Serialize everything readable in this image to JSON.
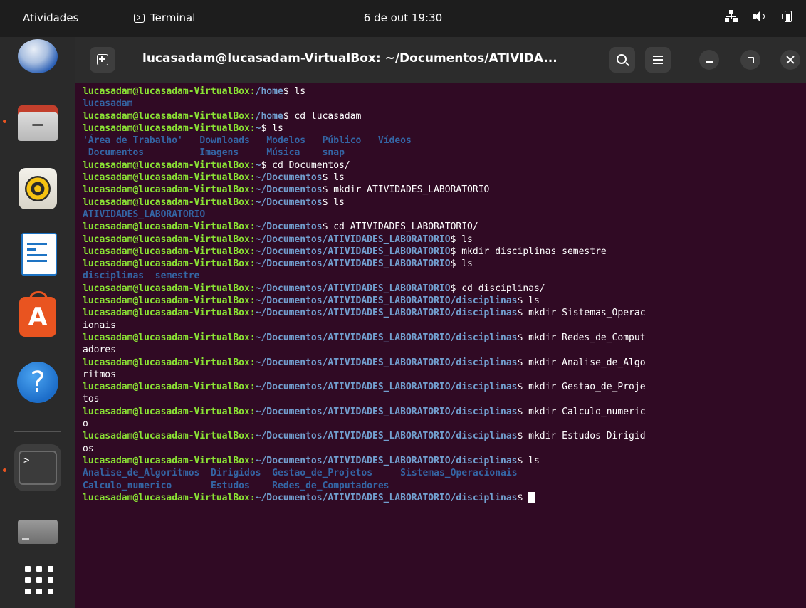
{
  "topbar": {
    "activities": "Atividades",
    "app_name": "Terminal",
    "clock": "6 de out  19:30"
  },
  "dock": {
    "items": [
      "thunderbird-icon",
      "files-icon",
      "rhythmbox-icon",
      "writer-icon",
      "app-center-icon",
      "help-icon",
      "terminal-icon",
      "drive-icon",
      "show-apps-icon"
    ],
    "terminal_prompt": ">_"
  },
  "window": {
    "title": "lucasadam@lucasadam-VirtualBox: ~/Documentos/ATIVIDA..."
  },
  "terminal": {
    "user_host": "lucasadam@lucasadam-VirtualBox",
    "lines": [
      {
        "type": "prompt",
        "path": "/home",
        "cmd": " ls"
      },
      {
        "type": "output",
        "segs": [
          {
            "t": "lucasadam",
            "c": "d"
          }
        ]
      },
      {
        "type": "prompt",
        "path": "/home",
        "cmd": " cd lucasadam"
      },
      {
        "type": "prompt",
        "path": "~",
        "cmd": " ls"
      },
      {
        "type": "output",
        "segs": [
          {
            "t": "'Área de Trabalho'",
            "c": "d"
          },
          {
            "t": "   "
          },
          {
            "t": "Downloads",
            "c": "d"
          },
          {
            "t": "   "
          },
          {
            "t": "Modelos",
            "c": "d"
          },
          {
            "t": "   "
          },
          {
            "t": "Público",
            "c": "d"
          },
          {
            "t": "   "
          },
          {
            "t": "Vídeos",
            "c": "d"
          }
        ]
      },
      {
        "type": "output",
        "segs": [
          {
            "t": " "
          },
          {
            "t": "Documentos",
            "c": "d"
          },
          {
            "t": "          "
          },
          {
            "t": "Imagens",
            "c": "d"
          },
          {
            "t": "     "
          },
          {
            "t": "Música",
            "c": "d"
          },
          {
            "t": "    "
          },
          {
            "t": "snap",
            "c": "d"
          }
        ]
      },
      {
        "type": "prompt",
        "path": "~",
        "cmd": " cd Documentos/"
      },
      {
        "type": "prompt",
        "path": "~/Documentos",
        "cmd": " ls"
      },
      {
        "type": "prompt",
        "path": "~/Documentos",
        "cmd": " mkdir ATIVIDADES_LABORATORIO"
      },
      {
        "type": "prompt",
        "path": "~/Documentos",
        "cmd": " ls"
      },
      {
        "type": "output",
        "segs": [
          {
            "t": "ATIVIDADES_LABORATORIO",
            "c": "d"
          }
        ]
      },
      {
        "type": "prompt",
        "path": "~/Documentos",
        "cmd": " cd ATIVIDADES_LABORATORIO/"
      },
      {
        "type": "prompt",
        "path": "~/Documentos/ATIVIDADES_LABORATORIO",
        "cmd": " ls"
      },
      {
        "type": "prompt",
        "path": "~/Documentos/ATIVIDADES_LABORATORIO",
        "cmd": " mkdir disciplinas semestre"
      },
      {
        "type": "prompt",
        "path": "~/Documentos/ATIVIDADES_LABORATORIO",
        "cmd": " ls"
      },
      {
        "type": "output",
        "segs": [
          {
            "t": "disciplinas",
            "c": "d"
          },
          {
            "t": "  "
          },
          {
            "t": "semestre",
            "c": "d"
          }
        ]
      },
      {
        "type": "prompt",
        "path": "~/Documentos/ATIVIDADES_LABORATORIO",
        "cmd": " cd disciplinas/"
      },
      {
        "type": "prompt",
        "path": "~/Documentos/ATIVIDADES_LABORATORIO/disciplinas",
        "cmd": " ls"
      },
      {
        "type": "prompt",
        "path": "~/Documentos/ATIVIDADES_LABORATORIO/disciplinas",
        "cmd": " mkdir Sistemas_Operac"
      },
      {
        "type": "output",
        "segs": [
          {
            "t": "ionais"
          }
        ]
      },
      {
        "type": "prompt",
        "path": "~/Documentos/ATIVIDADES_LABORATORIO/disciplinas",
        "cmd": " mkdir Redes_de_Comput"
      },
      {
        "type": "output",
        "segs": [
          {
            "t": "adores"
          }
        ]
      },
      {
        "type": "prompt",
        "path": "~/Documentos/ATIVIDADES_LABORATORIO/disciplinas",
        "cmd": " mkdir Analise_de_Algo"
      },
      {
        "type": "output",
        "segs": [
          {
            "t": "ritmos"
          }
        ]
      },
      {
        "type": "prompt",
        "path": "~/Documentos/ATIVIDADES_LABORATORIO/disciplinas",
        "cmd": " mkdir Gestao_de_Proje"
      },
      {
        "type": "output",
        "segs": [
          {
            "t": "tos"
          }
        ]
      },
      {
        "type": "prompt",
        "path": "~/Documentos/ATIVIDADES_LABORATORIO/disciplinas",
        "cmd": " mkdir Calculo_numeric"
      },
      {
        "type": "output",
        "segs": [
          {
            "t": "o"
          }
        ]
      },
      {
        "type": "prompt",
        "path": "~/Documentos/ATIVIDADES_LABORATORIO/disciplinas",
        "cmd": " mkdir Estudos Dirigid"
      },
      {
        "type": "output",
        "segs": [
          {
            "t": "os"
          }
        ]
      },
      {
        "type": "prompt",
        "path": "~/Documentos/ATIVIDADES_LABORATORIO/disciplinas",
        "cmd": " ls"
      },
      {
        "type": "output",
        "segs": [
          {
            "t": "Analise_de_Algoritmos",
            "c": "d"
          },
          {
            "t": "  "
          },
          {
            "t": "Dirigidos",
            "c": "d"
          },
          {
            "t": "  "
          },
          {
            "t": "Gestao_de_Projetos",
            "c": "d"
          },
          {
            "t": "     "
          },
          {
            "t": "Sistemas_Operacionais",
            "c": "d"
          }
        ]
      },
      {
        "type": "output",
        "segs": [
          {
            "t": "Calculo_numerico",
            "c": "d"
          },
          {
            "t": "       "
          },
          {
            "t": "Estudos",
            "c": "d"
          },
          {
            "t": "    "
          },
          {
            "t": "Redes_de_Computadores",
            "c": "d"
          }
        ]
      },
      {
        "type": "prompt",
        "path": "~/Documentos/ATIVIDADES_LABORATORIO/disciplinas",
        "cmd": " ",
        "cursor": true
      }
    ]
  }
}
